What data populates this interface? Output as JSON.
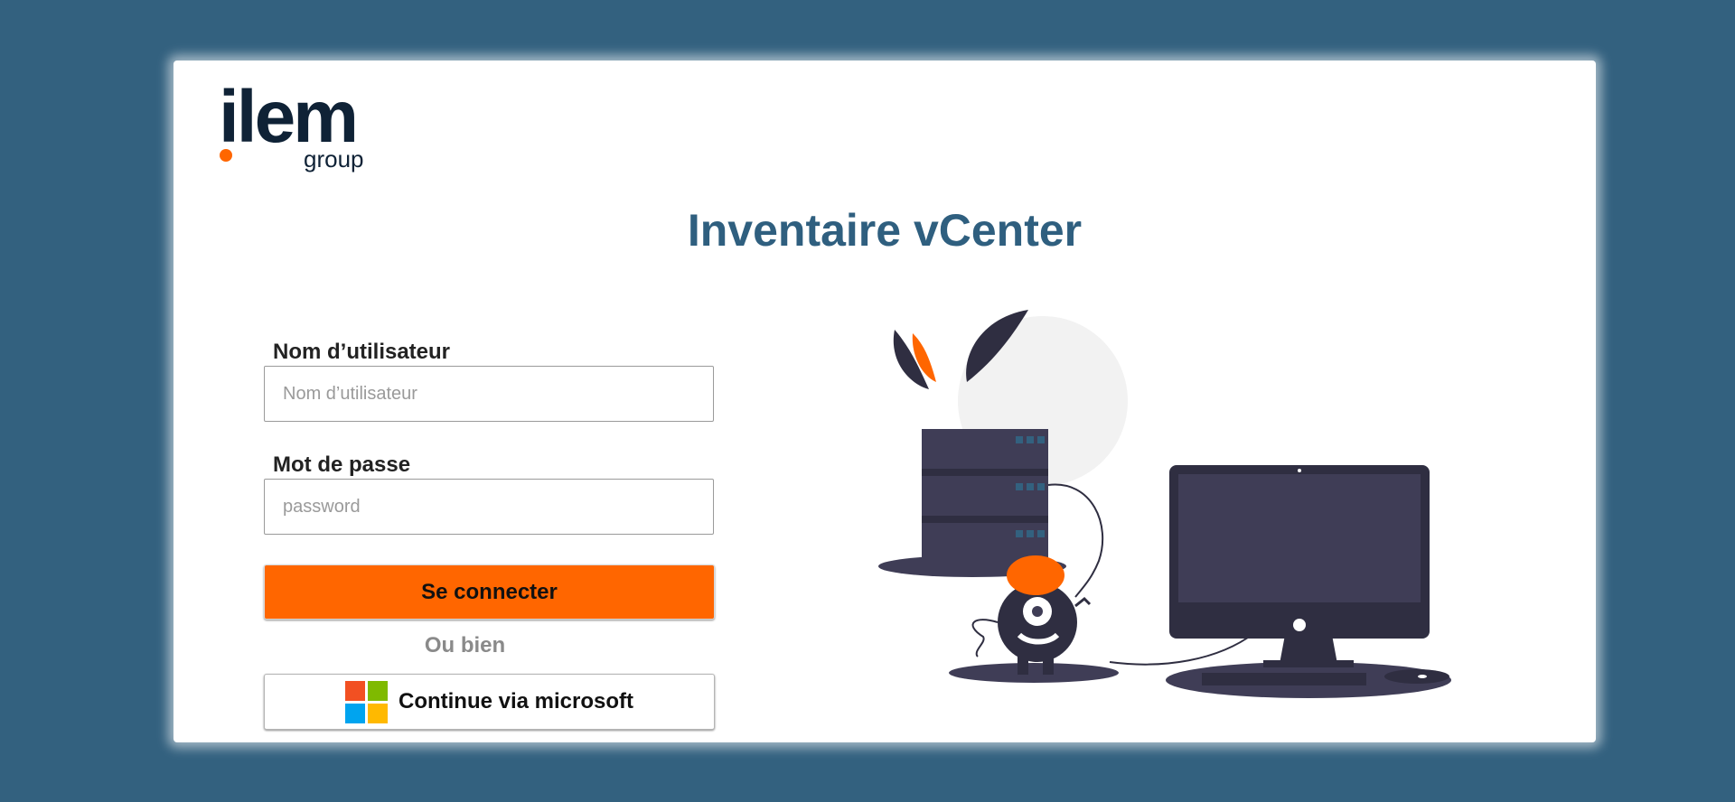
{
  "logo": {
    "word": "ilem",
    "sub": "group",
    "accent_color": "#ff6600",
    "text_color": "#0f2236"
  },
  "title": "Inventaire vCenter",
  "form": {
    "username": {
      "label": "Nom d’utilisateur",
      "placeholder": "Nom d’utilisateur",
      "value": ""
    },
    "password": {
      "label": "Mot de passe",
      "placeholder": "password",
      "value": ""
    },
    "login_button": "Se connecter",
    "separator": "Ou bien",
    "microsoft_button": "Continue via microsoft"
  },
  "colors": {
    "background": "#33617f",
    "title": "#2f5f7f",
    "primary_button": "#ff6600",
    "ms_red": "#f25022",
    "ms_green": "#7fba00",
    "ms_blue": "#00a4ef",
    "ms_yellow": "#ffb900"
  },
  "illustration": {
    "icon": "server-monitor-illustration"
  }
}
